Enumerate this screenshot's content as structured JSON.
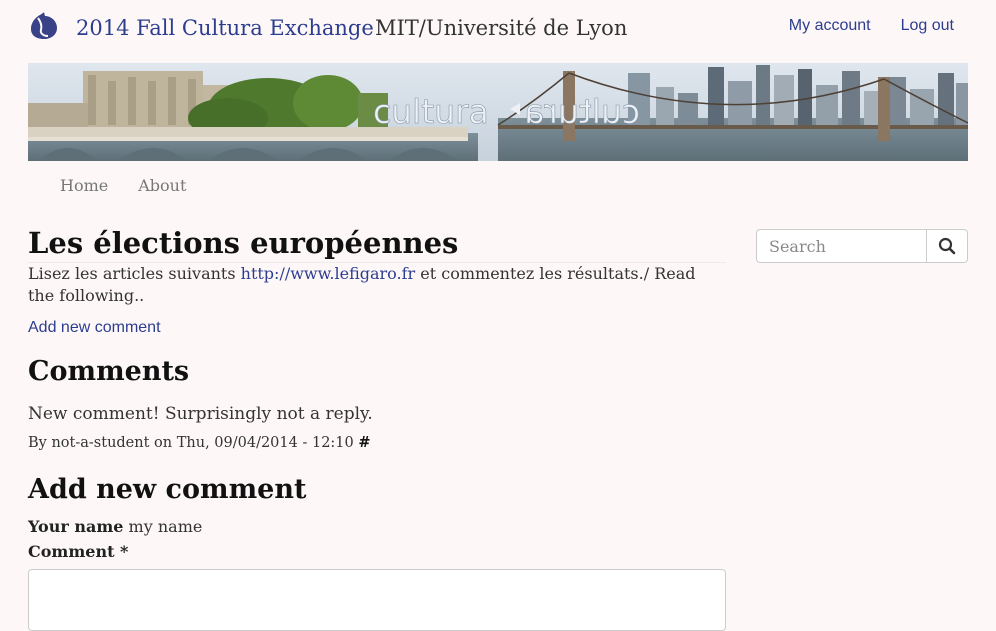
{
  "site": {
    "name": "2014 Fall Cultura Exchange",
    "slogan": "MIT/Université de Lyon",
    "brand_color": "#2c3d8f"
  },
  "user_menu": {
    "my_account": "My account",
    "log_out": "Log out"
  },
  "banner": {
    "logo_text": "cultura",
    "logo_text_mirror": "cultura",
    "image_alt": "Paris bridge and Manhattan skyline panorama"
  },
  "main_nav": {
    "items": [
      "Home",
      "About"
    ]
  },
  "search": {
    "placeholder": "Search",
    "icon": "search-icon"
  },
  "article": {
    "title": "Les élections européennes",
    "body_before": "Lisez les articles suivants ",
    "link_text": "http://www.lefigaro.fr",
    "body_after": " et commentez les résultats./ Read the following..",
    "add_comment_link": "Add new comment"
  },
  "comments": {
    "heading": "Comments",
    "items": [
      {
        "body": "New comment! Surprisingly not a reply.",
        "meta": "By not-a-student on Thu, 09/04/2014 - 12:10 ",
        "permalink": "#"
      }
    ]
  },
  "comment_form": {
    "heading": "Add new comment",
    "name_label": "Your name",
    "name_value": "my name",
    "comment_label": "Comment *"
  }
}
